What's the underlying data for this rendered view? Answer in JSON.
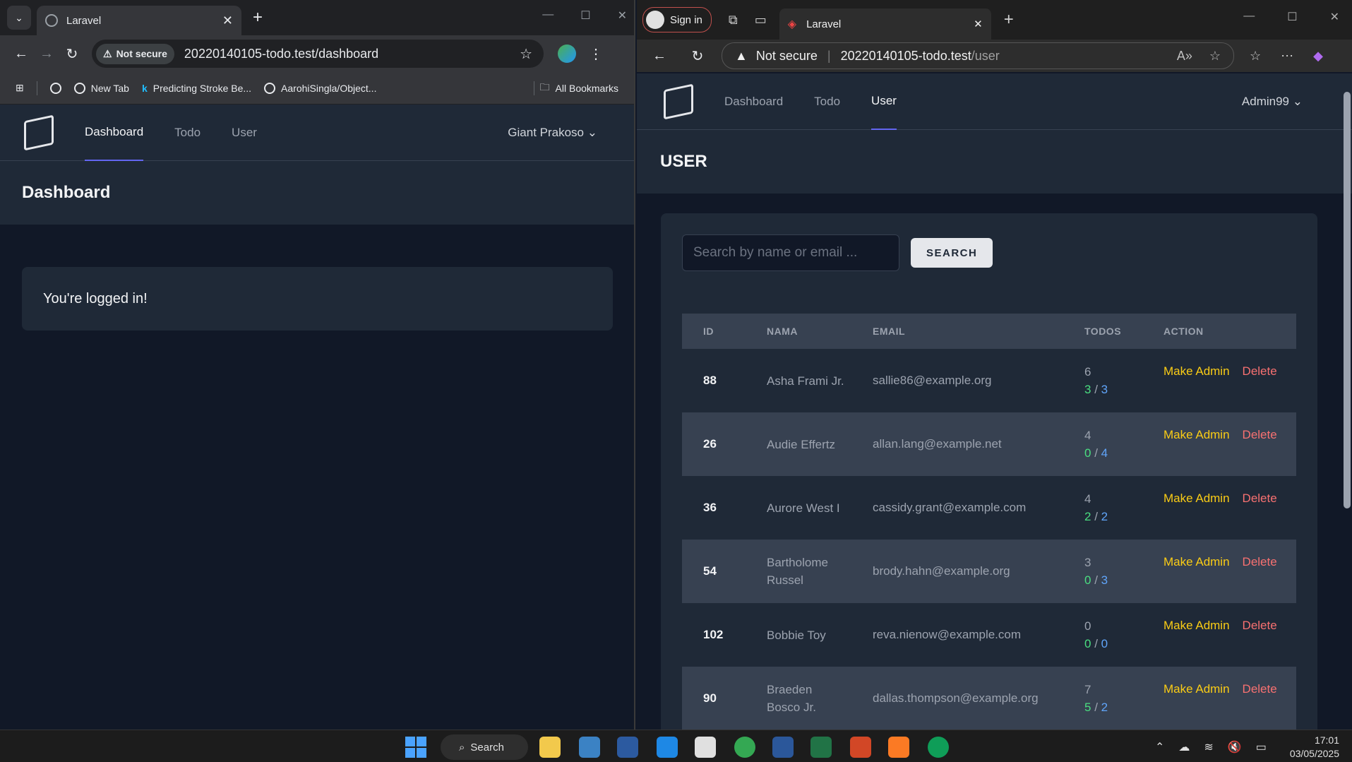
{
  "left_window": {
    "tab_title": "Laravel",
    "not_secure_label": "Not secure",
    "url": "20220140105-todo.test/dashboard",
    "bookmarks": [
      "New Tab",
      "Predicting Stroke Be...",
      "AarohiSingla/Object..."
    ],
    "all_bookmarks_label": "All Bookmarks",
    "nav": {
      "links": [
        "Dashboard",
        "Todo",
        "User"
      ],
      "active": "Dashboard",
      "user_name": "Giant Prakoso"
    },
    "header_title": "Dashboard",
    "message": "You're logged in!"
  },
  "right_window": {
    "sign_in_label": "Sign in",
    "tab_title": "Laravel",
    "not_secure_label": "Not secure",
    "url_host": "20220140105-todo.test",
    "url_path": "/user",
    "nav": {
      "links": [
        "Dashboard",
        "Todo",
        "User"
      ],
      "active": "User",
      "user_name": "Admin99"
    },
    "header_title": "USER",
    "search": {
      "placeholder": "Search by name or email ...",
      "button_label": "SEARCH"
    },
    "table": {
      "columns": [
        "ID",
        "NAMA",
        "EMAIL",
        "TODOS",
        "ACTION"
      ],
      "rows": [
        {
          "id": "88",
          "name": "Asha Frami Jr.",
          "email": "sallie86@example.org",
          "todos": "6",
          "done": "3",
          "total": "3"
        },
        {
          "id": "26",
          "name": "Audie Effertz",
          "email": "allan.lang@example.net",
          "todos": "4",
          "done": "0",
          "total": "4"
        },
        {
          "id": "36",
          "name": "Aurore West I",
          "email": "cassidy.grant@example.com",
          "todos": "4",
          "done": "2",
          "total": "2"
        },
        {
          "id": "54",
          "name": "Bartholome Russel",
          "email": "brody.hahn@example.org",
          "todos": "3",
          "done": "0",
          "total": "3"
        },
        {
          "id": "102",
          "name": "Bobbie Toy",
          "email": "reva.nienow@example.com",
          "todos": "0",
          "done": "0",
          "total": "0"
        },
        {
          "id": "90",
          "name": "Braeden Bosco Jr.",
          "email": "dallas.thompson@example.org",
          "todos": "7",
          "done": "5",
          "total": "2"
        }
      ],
      "action_make_admin": "Make Admin",
      "action_delete": "Delete"
    }
  },
  "taskbar": {
    "search_label": "Search",
    "time": "17:01",
    "date": "03/05/2025"
  }
}
